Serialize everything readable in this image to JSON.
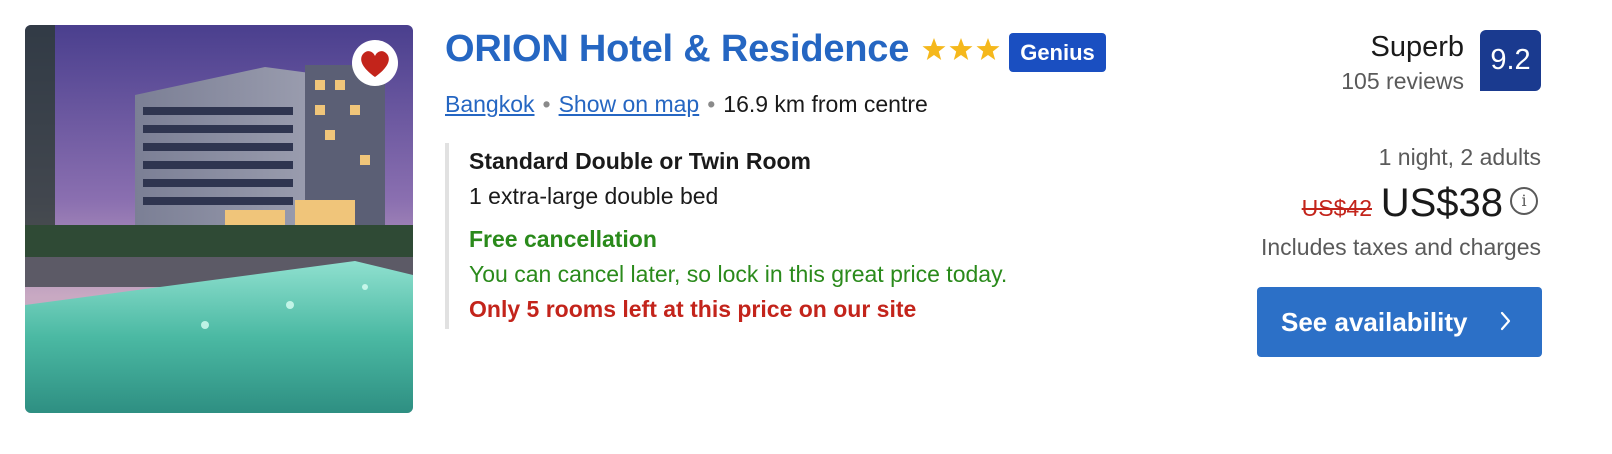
{
  "property": {
    "name": "ORION Hotel & Residence",
    "star_rating": 3,
    "badge": "Genius",
    "photo_icon": "hotel-photo",
    "favorite_icon": "heart-icon"
  },
  "location": {
    "city": "Bangkok",
    "map_link": "Show on map",
    "distance": "16.9 km from centre"
  },
  "room": {
    "name": "Standard Double or Twin Room",
    "bed": "1 extra-large double bed",
    "cancellation_title": "Free cancellation",
    "cancellation_desc": "You can cancel later, so lock in this great price today.",
    "scarcity": "Only 5 rooms left at this price on our site"
  },
  "review": {
    "word": "Superb",
    "count": "105 reviews",
    "score": "9.2"
  },
  "price": {
    "stay": "1 night, 2 adults",
    "original": "US$42",
    "current": "US$38",
    "info_icon": "info-icon",
    "taxes": "Includes taxes and charges"
  },
  "cta": {
    "label": "See availability",
    "icon": "chevron-right-icon"
  },
  "colors": {
    "link_blue": "#2566c2",
    "genius_blue": "#1a4fc1",
    "score_blue": "#1a3a8f",
    "cta_blue": "#2c70c7",
    "green": "#2a8a1b",
    "red": "#c3241b",
    "star_yellow": "#f5b81c"
  }
}
